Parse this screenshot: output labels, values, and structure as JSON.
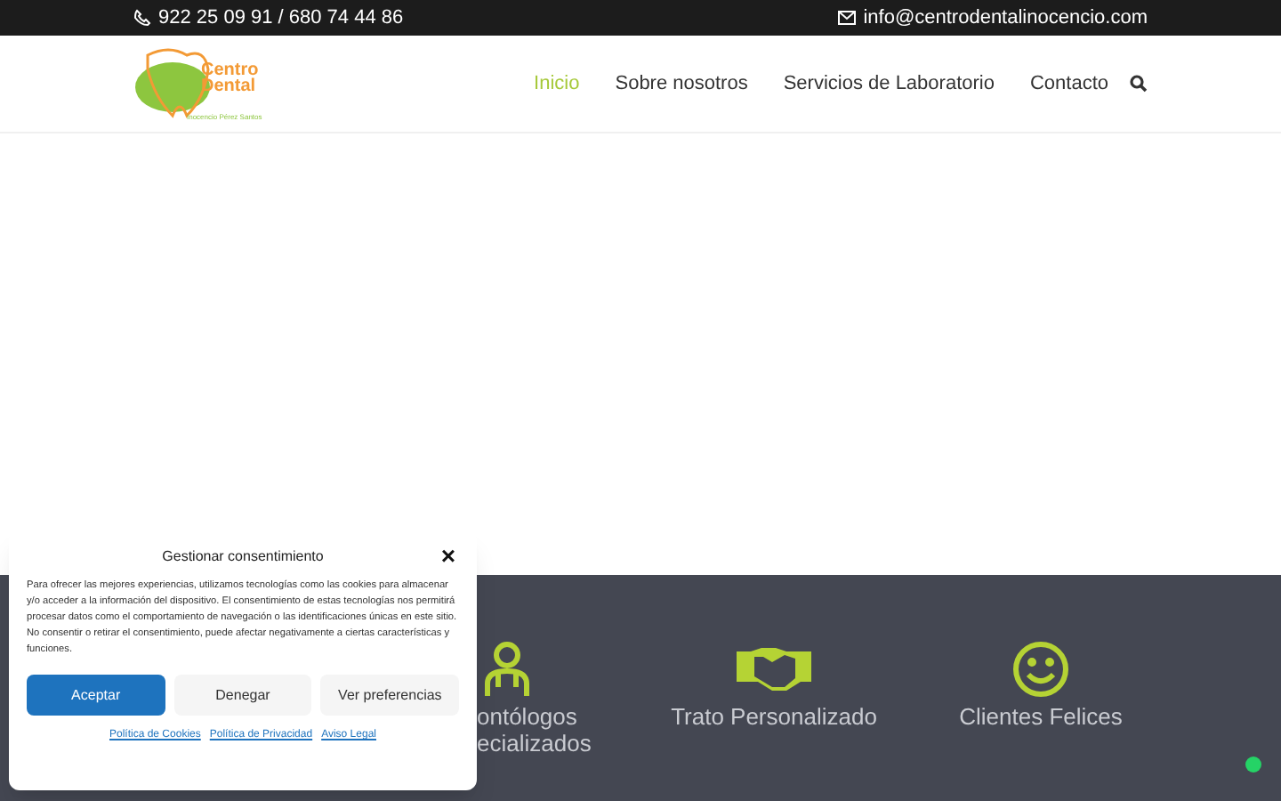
{
  "top_bar": {
    "phone": "922 25 09 91 / 680 74 44 86",
    "email": "info@centrodentalinocencio.com"
  },
  "logo": {
    "line_1": "Centro",
    "line_2": "Dental",
    "tagline": "Inocencio Pérez Santos"
  },
  "nav": [
    {
      "label": "Inicio",
      "selected": true
    },
    {
      "label": "Sobre nosotros",
      "selected": false
    },
    {
      "label": "Servicios de Laboratorio",
      "selected": false
    },
    {
      "label": "Contacto",
      "selected": false
    }
  ],
  "features": [
    {
      "kind": "person",
      "lines": [
        "ontólogos",
        "ecializados"
      ]
    },
    {
      "kind": "handshake",
      "lines": [
        "Trato Personalizado"
      ]
    },
    {
      "kind": "smile",
      "lines": [
        "Clientes Felices"
      ]
    }
  ],
  "consent": {
    "title": "Gestionar consentimiento",
    "close": "×",
    "text": "Para ofrecer las mejores experiencias, utilizamos tecnologías como las cookies para almacenar y/o acceder a la información del dispositivo. El consentimiento de estas tecnologías nos permitirá procesar datos como el comportamiento de navegación o las identificaciones únicas en este sitio. No consentir o retirar el consentimiento, puede afectar negativamente a ciertas características y funciones.",
    "buttons": [
      {
        "label": "Aceptar",
        "kind": "primary"
      },
      {
        "label": "Denegar",
        "kind": "secondary"
      },
      {
        "label": "Ver preferencias",
        "kind": "secondary"
      }
    ],
    "links": [
      "Política de Cookies",
      "Política de Privacidad",
      "Aviso Legal"
    ]
  }
}
